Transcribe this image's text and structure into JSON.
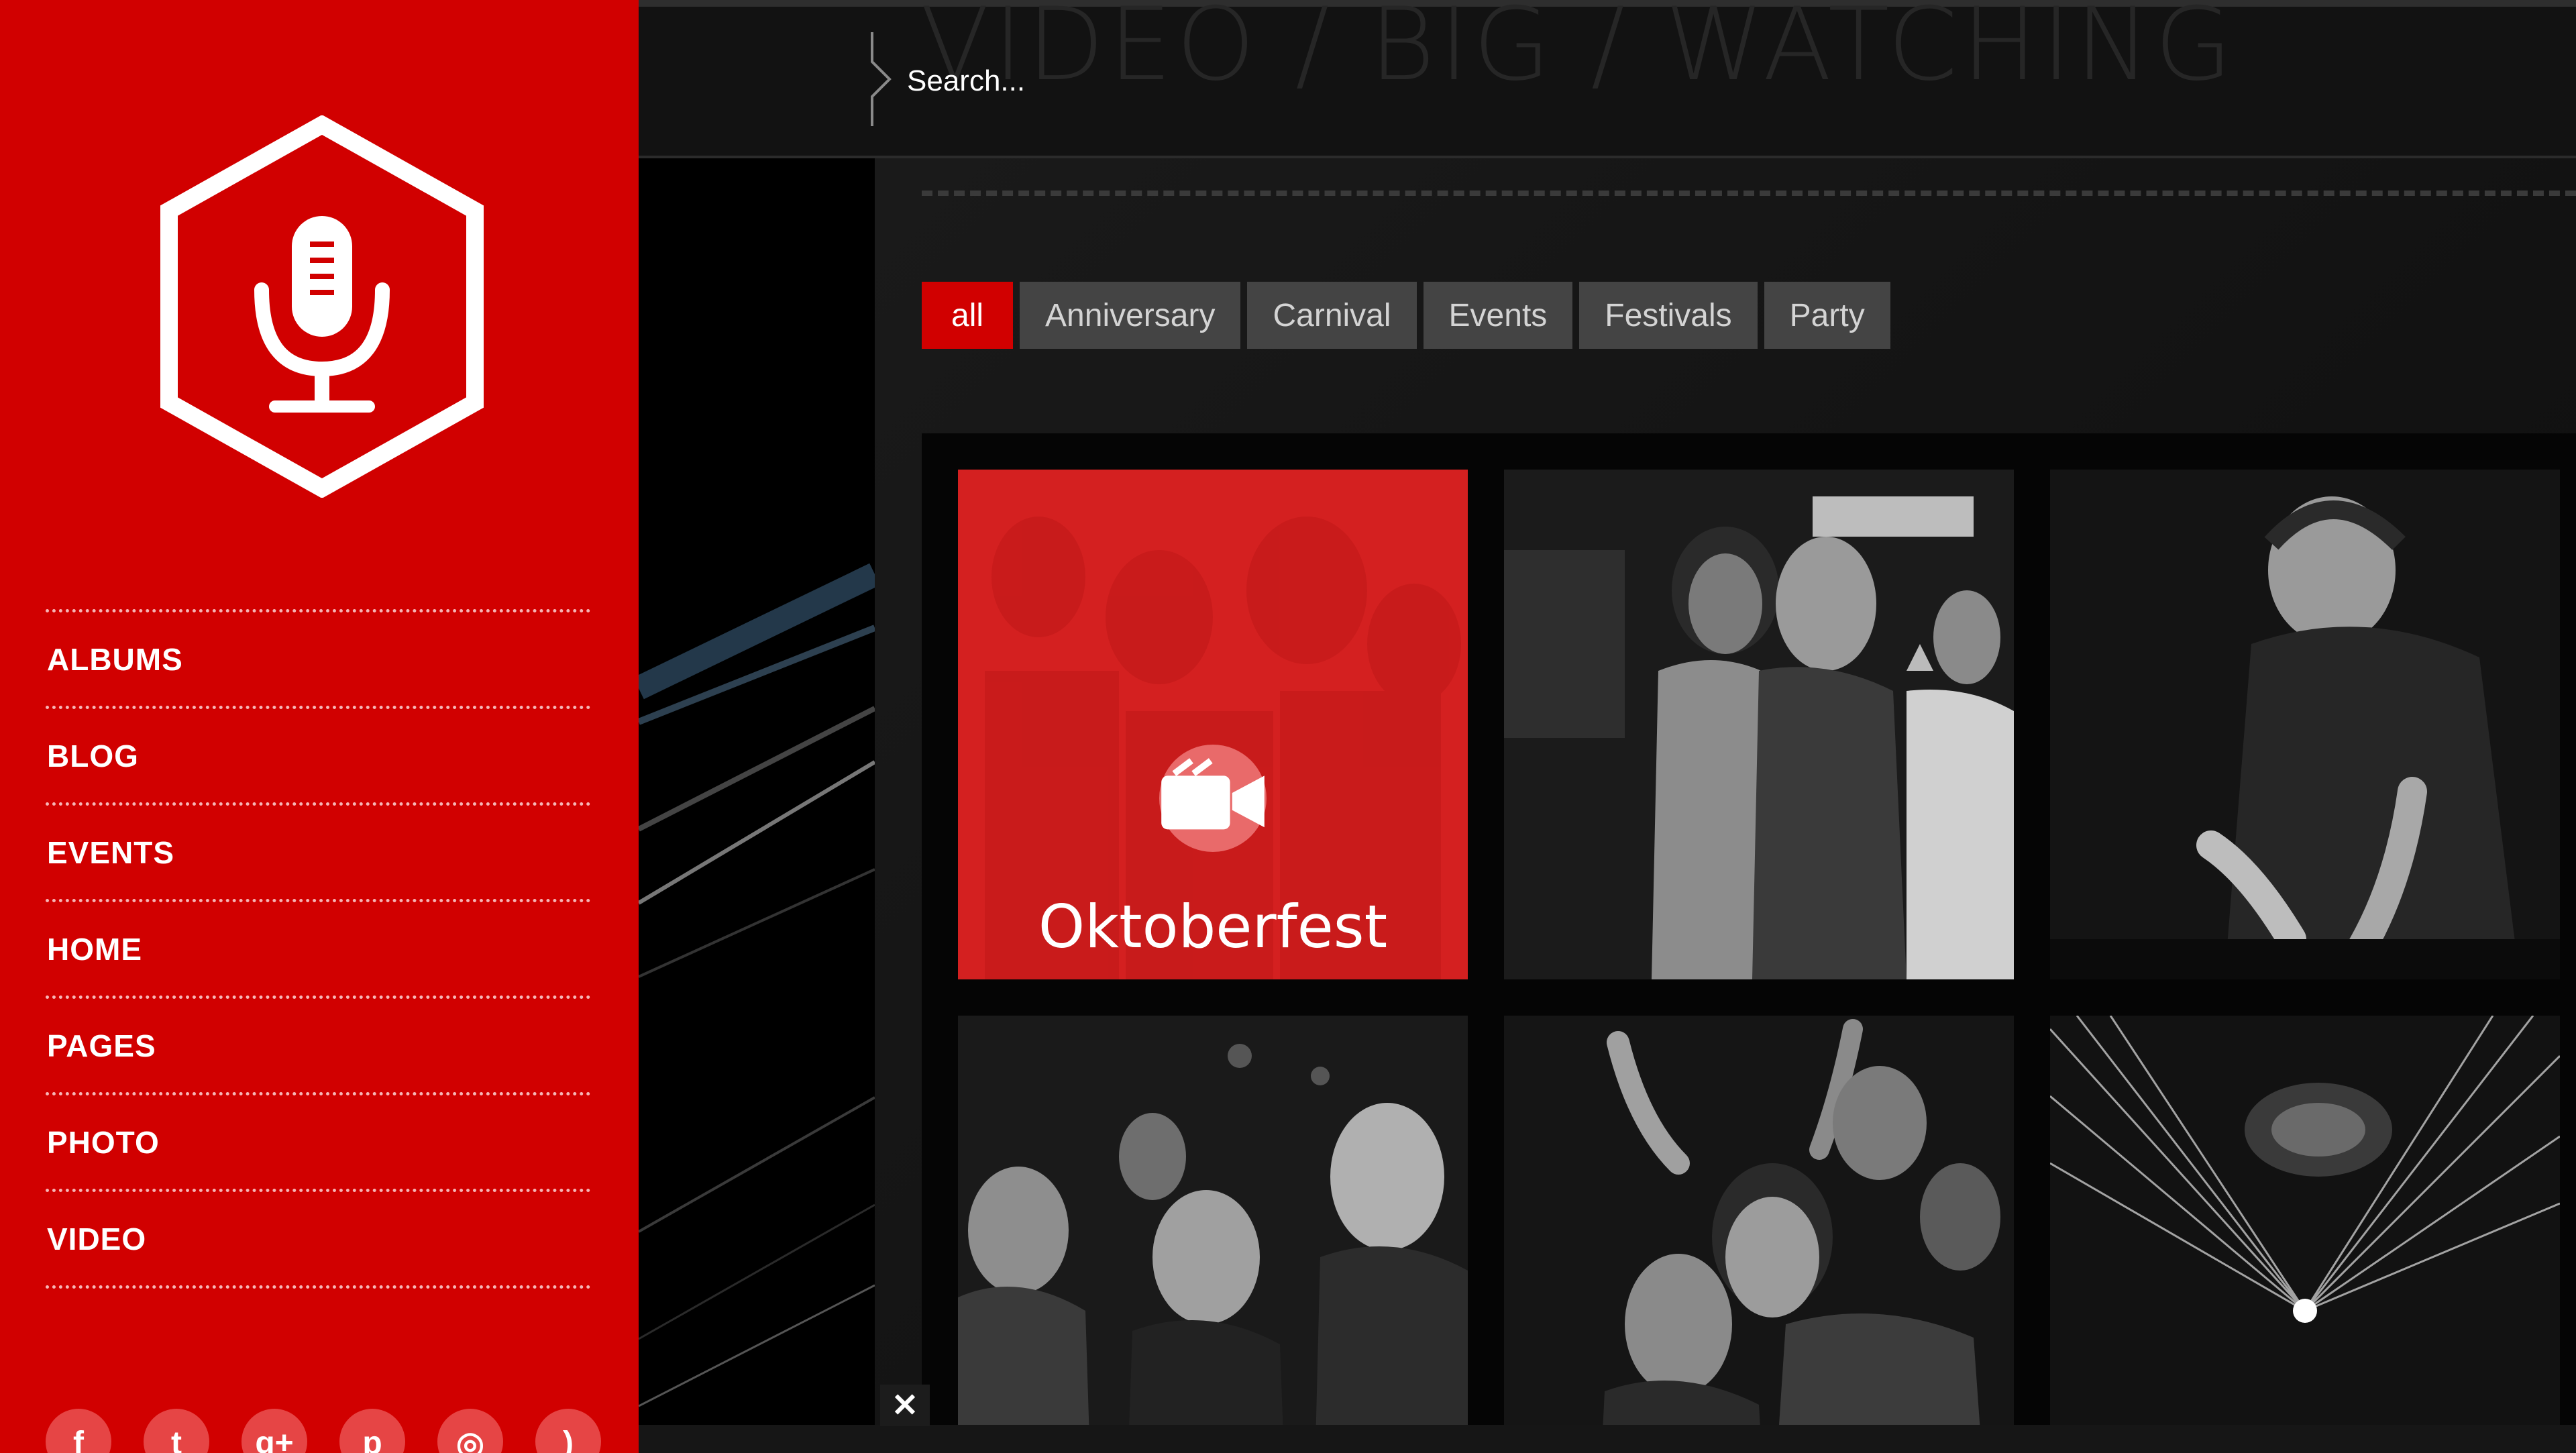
{
  "header": {
    "watermark": "VIDEO / BIG / WATCHING",
    "search_placeholder": "Search..."
  },
  "sidebar": {
    "logo_icon": "microphone-icon",
    "nav_items": [
      {
        "label": "ALBUMS"
      },
      {
        "label": "BLOG"
      },
      {
        "label": "EVENTS"
      },
      {
        "label": "HOME"
      },
      {
        "label": "PAGES"
      },
      {
        "label": "PHOTO"
      },
      {
        "label": "VIDEO"
      }
    ],
    "social_icons": [
      {
        "name": "facebook-icon",
        "glyph": "f"
      },
      {
        "name": "twitter-icon",
        "glyph": "t"
      },
      {
        "name": "google-plus-icon",
        "glyph": "g+"
      },
      {
        "name": "pinterest-icon",
        "glyph": "p"
      },
      {
        "name": "dribbble-icon",
        "glyph": "◎"
      },
      {
        "name": "rss-icon",
        "glyph": ")"
      }
    ]
  },
  "filters": {
    "active": "all",
    "items": [
      "all",
      "Anniversary",
      "Carnival",
      "Events",
      "Festivals",
      "Party"
    ]
  },
  "gallery": {
    "featured": {
      "title": "Oktoberfest",
      "icon": "video-camera-icon"
    },
    "photos": [
      {
        "name": "photo-club-couple"
      },
      {
        "name": "photo-dj-mixing"
      },
      {
        "name": "photo-smiling-crowd"
      },
      {
        "name": "photo-dancing-crowd"
      },
      {
        "name": "photo-stage-lasers"
      }
    ]
  },
  "theme": {
    "accent": "#d10000",
    "background": "#121212",
    "filter_bg": "#444444"
  }
}
